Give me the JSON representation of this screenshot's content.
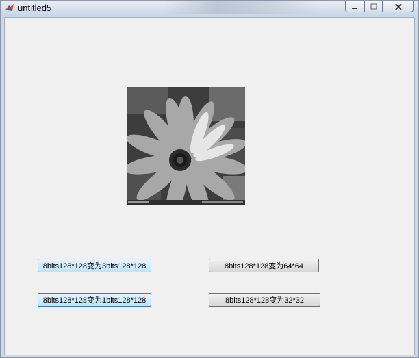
{
  "window": {
    "title": "untitled5"
  },
  "icons": {
    "app": "matlab-icon",
    "minimize": "minimize-icon",
    "maximize": "maximize-icon",
    "close": "close-icon"
  },
  "buttons": {
    "to_3bits": "8bits128*128变为3bits128*128",
    "to_64": "8bits128*128变为64*64",
    "to_1bit": "8bits128*128变为1bits128*128",
    "to_32": "8bits128*128变为32*32"
  },
  "image": {
    "content": "grayscale flower photo"
  }
}
